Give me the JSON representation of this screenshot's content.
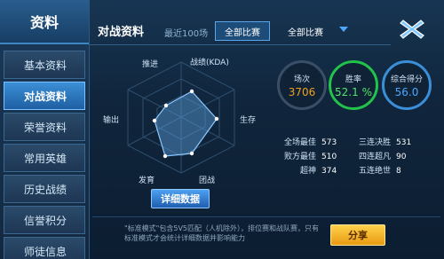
{
  "sidebar": {
    "title": "资料",
    "items": [
      {
        "label": "基本资料",
        "active": false
      },
      {
        "label": "对战资料",
        "active": true
      },
      {
        "label": "荣誉资料",
        "active": false
      },
      {
        "label": "常用英雄",
        "active": false
      },
      {
        "label": "历史战绩",
        "active": false
      },
      {
        "label": "信誉积分",
        "active": false
      },
      {
        "label": "师徒信息",
        "active": false
      }
    ]
  },
  "header": {
    "title": "对战资料",
    "recent_label": "最近100场",
    "tab_all": "全部比赛",
    "dropdown_value": "全部比赛",
    "close_icon": "close-x-icon"
  },
  "radar": {
    "labels": {
      "top_left": "推进",
      "top_right": "战绩(KDA)",
      "left": "输出",
      "right": "生存",
      "bottom_left": "发育",
      "bottom_right": "团战"
    },
    "detail_button": "详细数据"
  },
  "stats": {
    "matches": {
      "label": "场次",
      "value": "3706"
    },
    "winrate": {
      "label": "胜率",
      "value": "52.1 %"
    },
    "score": {
      "label": "综合得分",
      "value": "56.0"
    },
    "rows": [
      {
        "label": "全场最佳",
        "value": "573"
      },
      {
        "label": "败方最佳",
        "value": "510"
      },
      {
        "label": "超神",
        "value": "374"
      },
      {
        "label": "三连决胜",
        "value": "531"
      },
      {
        "label": "四连超凡",
        "value": "90"
      },
      {
        "label": "五连绝世",
        "value": "8"
      }
    ]
  },
  "footer": {
    "note": "\"标准模式\"包含5V5匹配（人机除外），排位赛和战队赛，只有标准模式才会统计详细数据并影响能力",
    "share_button": "分享"
  },
  "colors": {
    "accent_blue": "#3b8fd6",
    "winrate_green": "#22c34a",
    "matches_orange": "#f0a020",
    "score_blue": "#4aa8ff"
  }
}
